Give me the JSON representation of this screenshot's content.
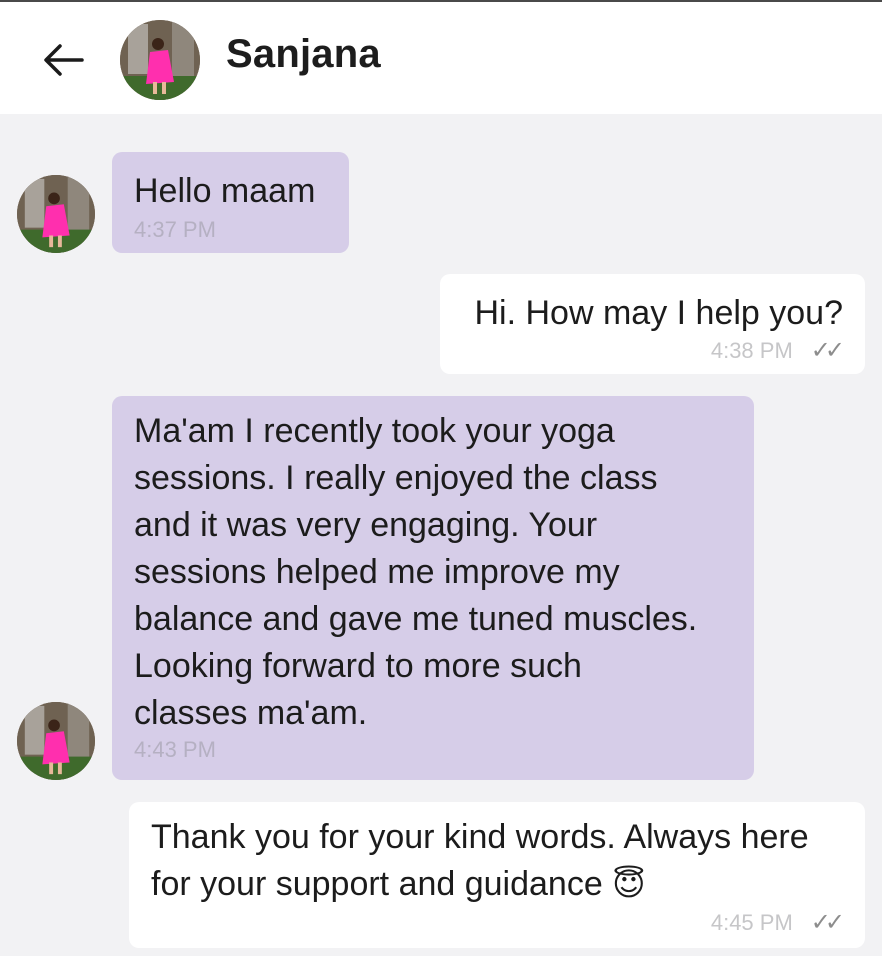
{
  "header": {
    "contact_name": "Sanjana"
  },
  "messages": [
    {
      "direction": "incoming",
      "text": "Hello maam",
      "time": "4:37 PM"
    },
    {
      "direction": "outgoing",
      "text": "Hi. How may I help you?",
      "time": "4:38 PM",
      "status": "✓✓"
    },
    {
      "direction": "incoming",
      "text": "Ma'am I recently took your yoga\nsessions. I really enjoyed the class\nand it was very engaging. Your\nsessions helped me improve my\nbalance and gave me tuned muscles.\nLooking forward to more such\nclasses ma'am.",
      "time": "4:43 PM"
    },
    {
      "direction": "outgoing",
      "text": "Thank you for your kind words. Always here\nfor your support and guidance",
      "emoji": "😇",
      "time": "4:45 PM",
      "status": "✓✓"
    }
  ],
  "colors": {
    "incoming_bubble": "#d6cde8",
    "outgoing_bubble": "#ffffff",
    "chat_background": "#f2f2f4"
  },
  "icons": {
    "back": "arrow-left-icon",
    "read_receipt": "double-check-icon"
  }
}
